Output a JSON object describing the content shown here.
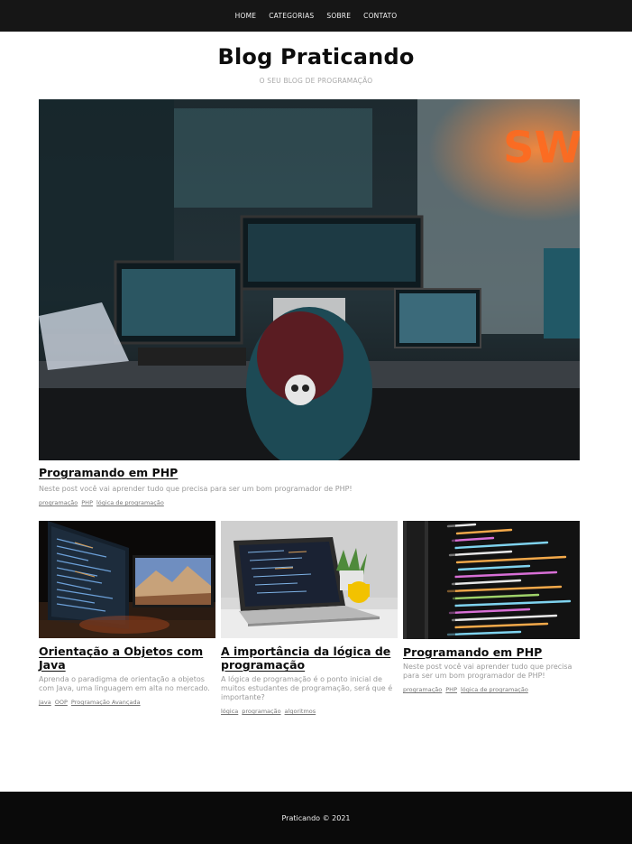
{
  "nav": {
    "items": [
      "HOME",
      "CATEGORIAS",
      "SOBRE",
      "CONTATO"
    ]
  },
  "header": {
    "title": "Blog Praticando",
    "subtitle": "O SEU BLOG DE PROGRAMAÇÃO"
  },
  "featured": {
    "image_icon": "workspace-photo",
    "title": "Programando em PHP",
    "excerpt": "Neste post você vai aprender tudo que precisa para ser um bom programador de PHP!",
    "tags": [
      "programação",
      "PHP",
      "lógica de programação"
    ]
  },
  "posts": [
    {
      "image_icon": "monitors-photo",
      "title": "Orientação a Objetos com Java",
      "excerpt": "Aprenda o paradigma de orientação a objetos com Java, uma linguagem em alta no mercado.",
      "tags": [
        "Java",
        "OOP",
        "Programação Avançada"
      ]
    },
    {
      "image_icon": "laptop-photo",
      "title": "A importância da lógica de programação",
      "excerpt": "A lógica de programação é o ponto inicial de muitos estudantes de programação, será que é importante?",
      "tags": [
        "lógica",
        "programação",
        "algoritmos"
      ]
    },
    {
      "image_icon": "code-screen-photo",
      "title": "Programando em PHP",
      "excerpt": "Neste post você vai aprender tudo que precisa para ser um bom programador de PHP!",
      "tags": [
        "programação",
        "PHP",
        "lógica de programação"
      ]
    }
  ],
  "footer": {
    "text": "Praticando © 2021"
  },
  "colors": {
    "nav_bg": "#161616",
    "footer_bg": "#0a0a0a",
    "title": "#0d0d0d",
    "muted": "#9a9a9a"
  }
}
